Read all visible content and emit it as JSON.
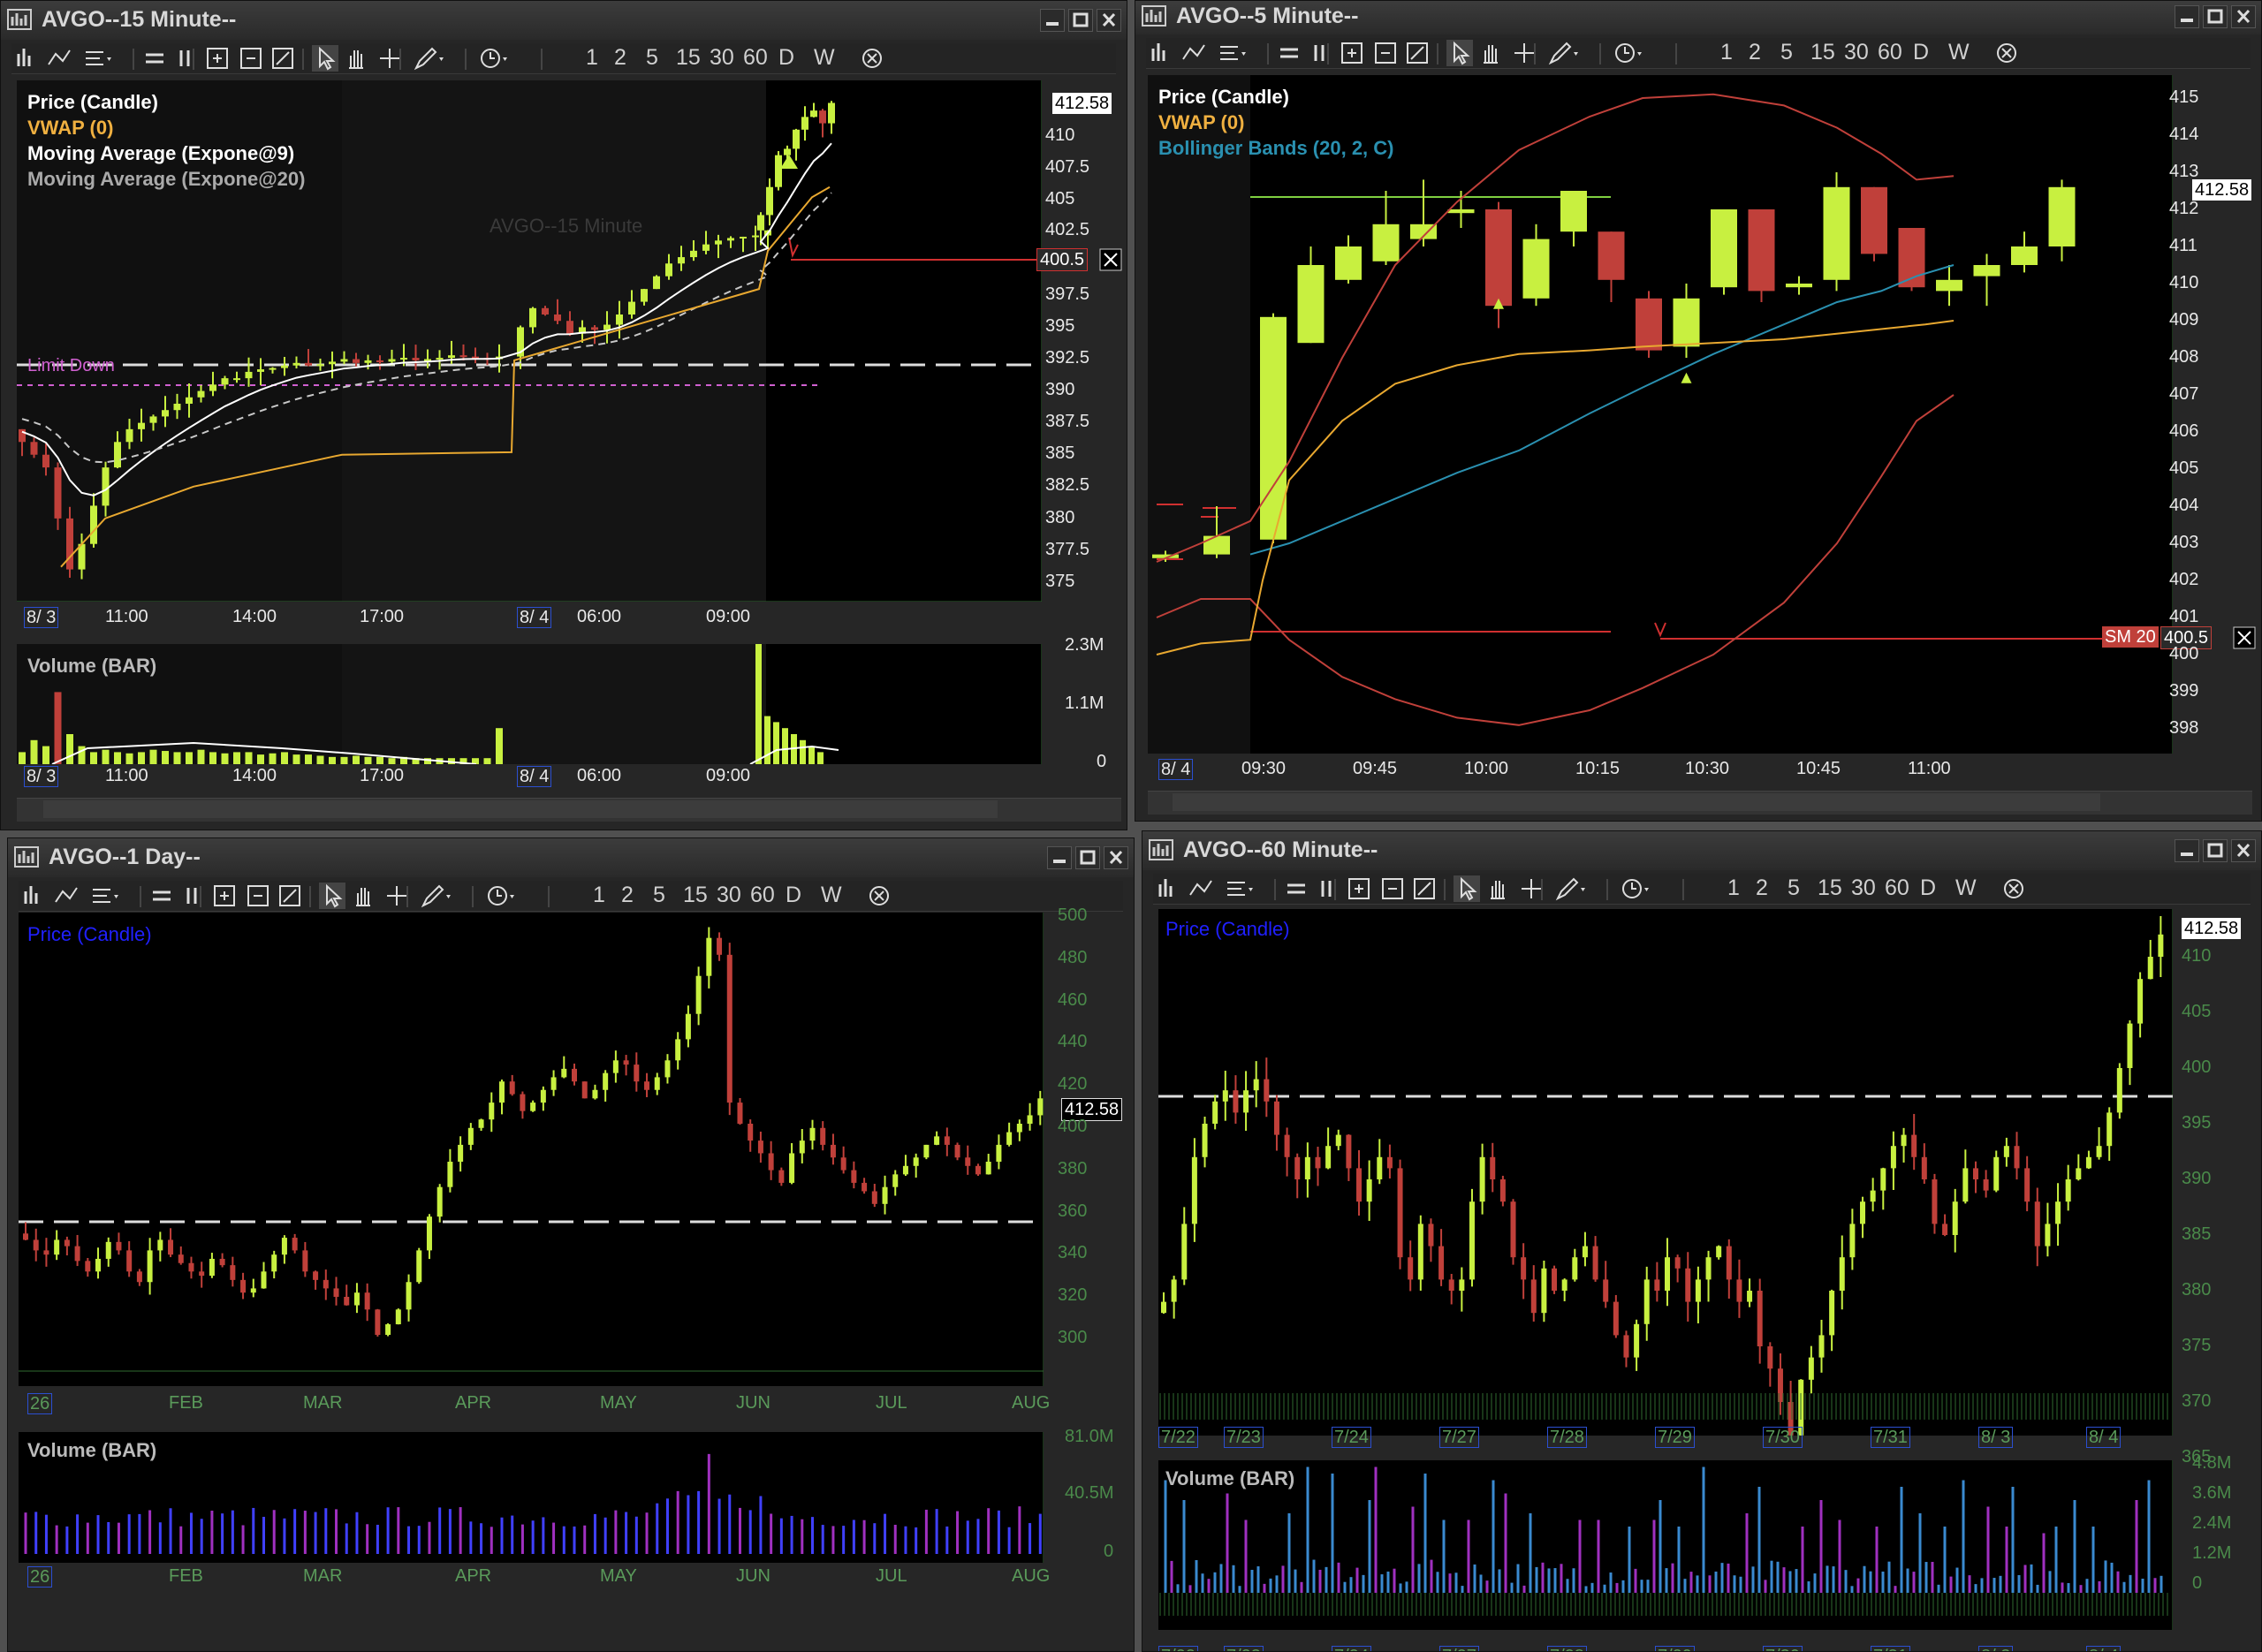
{
  "toolbar": {
    "buttons": [
      "1",
      "2",
      "5",
      "15",
      "30",
      "60",
      "D",
      "W"
    ]
  },
  "colors": {
    "up": "#c8f040",
    "down": "#c0403a",
    "vwap": "#e8a830",
    "ema9": "#ffffff",
    "ema20": "#c8c8c8",
    "bb": "#c0403a",
    "bbmid": "#2a90b0",
    "volume": "#c8f040",
    "dayvol": "#4040ff"
  },
  "w15": {
    "title": "AVGO--15 Minute--",
    "legend": {
      "price": "Price (Candle)",
      "vwap": "VWAP (0)",
      "ema9": "Moving Average (Expone@9)",
      "ema20": "Moving Average (Expone@20)"
    },
    "watermark": "AVGO--15 Minute",
    "limit_label": "Limit Down",
    "last_price": "412.58",
    "alert_price": "400.5",
    "y_ticks": [
      "410",
      "407.5",
      "405",
      "402.5",
      "397.5",
      "395",
      "392.5",
      "390",
      "387.5",
      "385",
      "382.5",
      "380",
      "377.5",
      "375"
    ],
    "x_labels": [
      "8/ 3",
      "11:00",
      "14:00",
      "17:00",
      "8/ 4",
      "06:00",
      "09:00"
    ],
    "volume": {
      "legend": "Volume (BAR)",
      "ticks": [
        "2.3M",
        "1.1M",
        "0"
      ]
    }
  },
  "w5": {
    "title": "AVGO--5 Minute--",
    "legend": {
      "price": "Price (Candle)",
      "vwap": "VWAP (0)",
      "bb": "Bollinger Bands (20, 2, C)"
    },
    "last_price": "412.58",
    "alert_label": "SM 20",
    "alert_price": "400.5",
    "y_ticks": [
      "415",
      "414",
      "413",
      "412",
      "411",
      "410",
      "409",
      "408",
      "407",
      "406",
      "405",
      "404",
      "403",
      "402",
      "401",
      "400",
      "399",
      "398"
    ],
    "x_labels": [
      "8/ 4",
      "09:30",
      "09:45",
      "10:00",
      "10:15",
      "10:30",
      "10:45",
      "11:00"
    ]
  },
  "w1d": {
    "title": "AVGO--1 Day--",
    "legend": {
      "price": "Price (Candle)"
    },
    "last_price": "412.58",
    "y_ticks": [
      "500",
      "480",
      "460",
      "440",
      "420",
      "400",
      "380",
      "360",
      "340",
      "320",
      "300"
    ],
    "x_labels": [
      "26",
      "FEB",
      "MAR",
      "APR",
      "MAY",
      "JUN",
      "JUL",
      "AUG"
    ],
    "volume": {
      "legend": "Volume (BAR)",
      "ticks": [
        "81.0M",
        "40.5M",
        "0"
      ]
    }
  },
  "w60": {
    "title": "AVGO--60 Minute--",
    "legend": {
      "price": "Price (Candle)"
    },
    "last_price": "412.58",
    "y_ticks": [
      "410",
      "405",
      "400",
      "395",
      "390",
      "385",
      "380",
      "375",
      "370",
      "365"
    ],
    "x_labels": [
      "7/22",
      "7/23",
      "7/24",
      "7/27",
      "7/28",
      "7/29",
      "7/30",
      "7/31",
      "8/ 3",
      "8/ 4"
    ],
    "volume": {
      "legend": "Volume (BAR)",
      "ticks": [
        "4.8M",
        "3.6M",
        "2.4M",
        "1.2M",
        "0"
      ]
    }
  }
}
